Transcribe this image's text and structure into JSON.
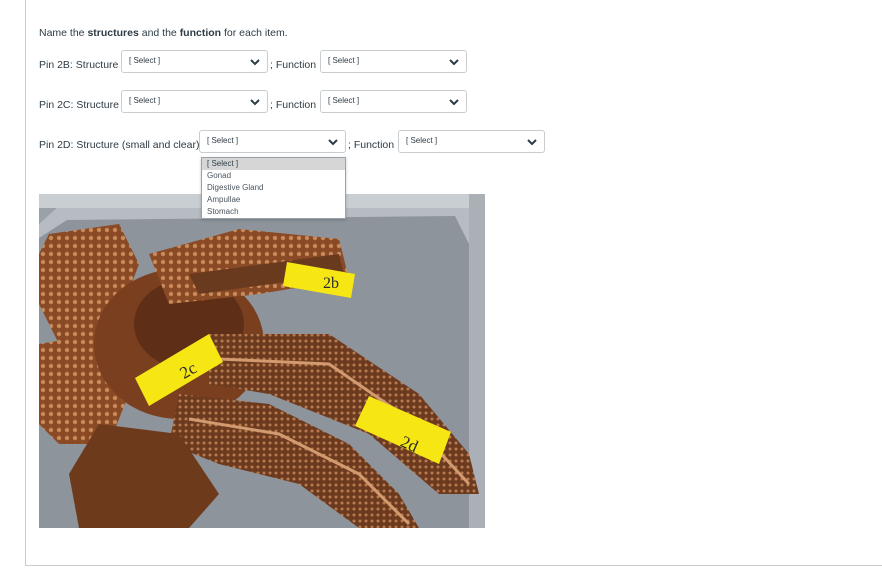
{
  "instructions": {
    "prefix": "Name the ",
    "bold1": "structures",
    "mid": " and the ",
    "bold2": "function",
    "suffix": " for each item."
  },
  "rows": [
    {
      "label": "Pin 2B: Structure",
      "structure_value": "[ Select ]",
      "function_label": "; Function",
      "function_value": "[ Select ]"
    },
    {
      "label": "Pin 2C: Structure",
      "structure_value": "[ Select ]",
      "function_label": "; Function",
      "function_value": "[ Select ]"
    },
    {
      "label": "Pin 2D: Structure (small and clear)",
      "structure_value": "[ Select ]",
      "function_label": "; Function",
      "function_value": "[ Select ]"
    }
  ],
  "dropdown_options": [
    "[ Select ]",
    "Gonad",
    "Digestive Gland",
    "Ampullae",
    "Stomach"
  ],
  "photo_tags": {
    "b": "2b",
    "c": "2c",
    "d": "2d"
  },
  "colors": {
    "border": "#c7cdd1",
    "text": "#2d3b45",
    "tag": "#f5e614"
  }
}
